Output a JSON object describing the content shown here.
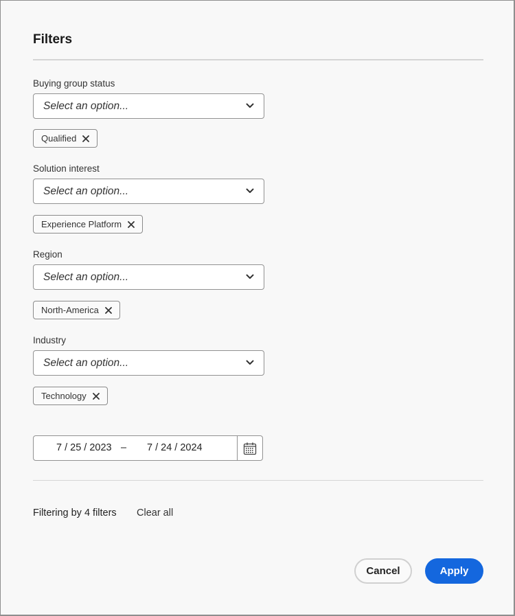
{
  "dialog": {
    "title": "Filters"
  },
  "filters": [
    {
      "label": "Buying group status",
      "placeholder": "Select an option...",
      "selected_tags": [
        "Qualified"
      ]
    },
    {
      "label": "Solution interest",
      "placeholder": "Select an option...",
      "selected_tags": [
        "Experience Platform"
      ]
    },
    {
      "label": "Region",
      "placeholder": "Select an option...",
      "selected_tags": [
        "North-America"
      ]
    },
    {
      "label": "Industry",
      "placeholder": "Select an option...",
      "selected_tags": [
        "Technology"
      ]
    }
  ],
  "date_range": {
    "start": "7 / 25 / 2023",
    "separator": "–",
    "end": "7 / 24 / 2024",
    "icon": "calendar-icon"
  },
  "summary": {
    "filter_count_text": "Filtering by 4 filters",
    "clear_all_label": "Clear all"
  },
  "footer": {
    "cancel_label": "Cancel",
    "apply_label": "Apply"
  },
  "colors": {
    "accent": "#1467de",
    "background": "#f8f8f8",
    "border": "#919191"
  }
}
